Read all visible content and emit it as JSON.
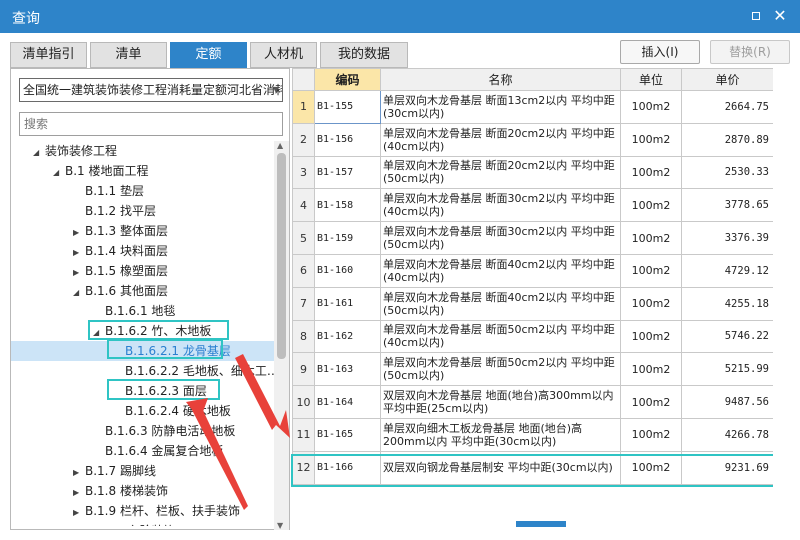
{
  "window": {
    "title": "查询"
  },
  "tabs": [
    {
      "label": "清单指引",
      "active": false
    },
    {
      "label": "清单",
      "active": false
    },
    {
      "label": "定额",
      "active": true
    },
    {
      "label": "人材机",
      "active": false
    },
    {
      "label": "我的数据",
      "active": false
    }
  ],
  "toolbar": {
    "insert_label": "插入(I)",
    "replace_label": "替换(R)"
  },
  "left": {
    "dropdown_value": "全国统一建筑装饰装修工程消耗量定额河北省消耗",
    "search_placeholder": "搜索",
    "tree": [
      {
        "label": "装饰装修工程",
        "level": 0,
        "expand": "open"
      },
      {
        "label": "B.1 楼地面工程",
        "level": 1,
        "expand": "open"
      },
      {
        "label": "B.1.1 垫层",
        "level": 2,
        "expand": "none"
      },
      {
        "label": "B.1.2 找平层",
        "level": 2,
        "expand": "none"
      },
      {
        "label": "B.1.3 整体面层",
        "level": 2,
        "expand": "closed"
      },
      {
        "label": "B.1.4 块料面层",
        "level": 2,
        "expand": "closed"
      },
      {
        "label": "B.1.5 橡塑面层",
        "level": 2,
        "expand": "closed"
      },
      {
        "label": "B.1.6 其他面层",
        "level": 2,
        "expand": "open"
      },
      {
        "label": "B.1.6.1 地毯",
        "level": 3,
        "expand": "none"
      },
      {
        "label": "B.1.6.2 竹、木地板",
        "level": 3,
        "expand": "open"
      },
      {
        "label": "B.1.6.2.1 龙骨基层",
        "level": 4,
        "expand": "none",
        "selected": true
      },
      {
        "label": "B.1.6.2.2 毛地板、细木工…",
        "level": 4,
        "expand": "none"
      },
      {
        "label": "B.1.6.2.3 面层",
        "level": 4,
        "expand": "none"
      },
      {
        "label": "B.1.6.2.4 硬木地板",
        "level": 4,
        "expand": "none"
      },
      {
        "label": "B.1.6.3 防静电活动地板",
        "level": 3,
        "expand": "none"
      },
      {
        "label": "B.1.6.4 金属复合地板",
        "level": 3,
        "expand": "none"
      },
      {
        "label": "B.1.7 踢脚线",
        "level": 2,
        "expand": "closed"
      },
      {
        "label": "B.1.8 楼梯装饰",
        "level": 2,
        "expand": "closed"
      },
      {
        "label": "B.1.9 栏杆、栏板、扶手装饰",
        "level": 2,
        "expand": "closed"
      },
      {
        "label": "B.1.10 台阶装饰",
        "level": 2,
        "expand": "closed"
      }
    ]
  },
  "table": {
    "headers": {
      "index": "",
      "code": "编码",
      "name": "名称",
      "unit": "单位",
      "price": "单价"
    },
    "rows": [
      {
        "index": "1",
        "code": "B1-155",
        "name": "单层双向木龙骨基层 断面13cm2以内 平均中距(30cm以内)",
        "unit": "100m2",
        "price": "2664.75"
      },
      {
        "index": "2",
        "code": "B1-156",
        "name": "单层双向木龙骨基层 断面20cm2以内 平均中距(40cm以内)",
        "unit": "100m2",
        "price": "2870.89"
      },
      {
        "index": "3",
        "code": "B1-157",
        "name": "单层双向木龙骨基层 断面20cm2以内 平均中距(50cm以内)",
        "unit": "100m2",
        "price": "2530.33"
      },
      {
        "index": "4",
        "code": "B1-158",
        "name": "单层双向木龙骨基层 断面30cm2以内 平均中距(40cm以内)",
        "unit": "100m2",
        "price": "3778.65"
      },
      {
        "index": "5",
        "code": "B1-159",
        "name": "单层双向木龙骨基层 断面30cm2以内 平均中距(50cm以内)",
        "unit": "100m2",
        "price": "3376.39"
      },
      {
        "index": "6",
        "code": "B1-160",
        "name": "单层双向木龙骨基层 断面40cm2以内 平均中距(40cm以内)",
        "unit": "100m2",
        "price": "4729.12"
      },
      {
        "index": "7",
        "code": "B1-161",
        "name": "单层双向木龙骨基层 断面40cm2以内 平均中距(50cm以内)",
        "unit": "100m2",
        "price": "4255.18"
      },
      {
        "index": "8",
        "code": "B1-162",
        "name": "单层双向木龙骨基层 断面50cm2以内 平均中距(40cm以内)",
        "unit": "100m2",
        "price": "5746.22"
      },
      {
        "index": "9",
        "code": "B1-163",
        "name": "单层双向木龙骨基层 断面50cm2以内 平均中距(50cm以内)",
        "unit": "100m2",
        "price": "5215.99"
      },
      {
        "index": "10",
        "code": "B1-164",
        "name": "双层双向木龙骨基层 地面(地台)高300mm以内 平均中距(25cm以内)",
        "unit": "100m2",
        "price": "9487.56"
      },
      {
        "index": "11",
        "code": "B1-165",
        "name": "单层双向细木工板龙骨基层 地面(地台)高200mm以内 平均中距(30cm以内)",
        "unit": "100m2",
        "price": "4266.78"
      },
      {
        "index": "12",
        "code": "B1-166",
        "name": "双层双向钢龙骨基层制安 平均中距(30cm以内)",
        "unit": "100m2",
        "price": "9231.69"
      }
    ]
  },
  "colors": {
    "accent": "#2e84c9",
    "highlight_box": "#2fc4c4",
    "arrow": "#e8413a",
    "sorted_header": "#fbe6a8"
  }
}
